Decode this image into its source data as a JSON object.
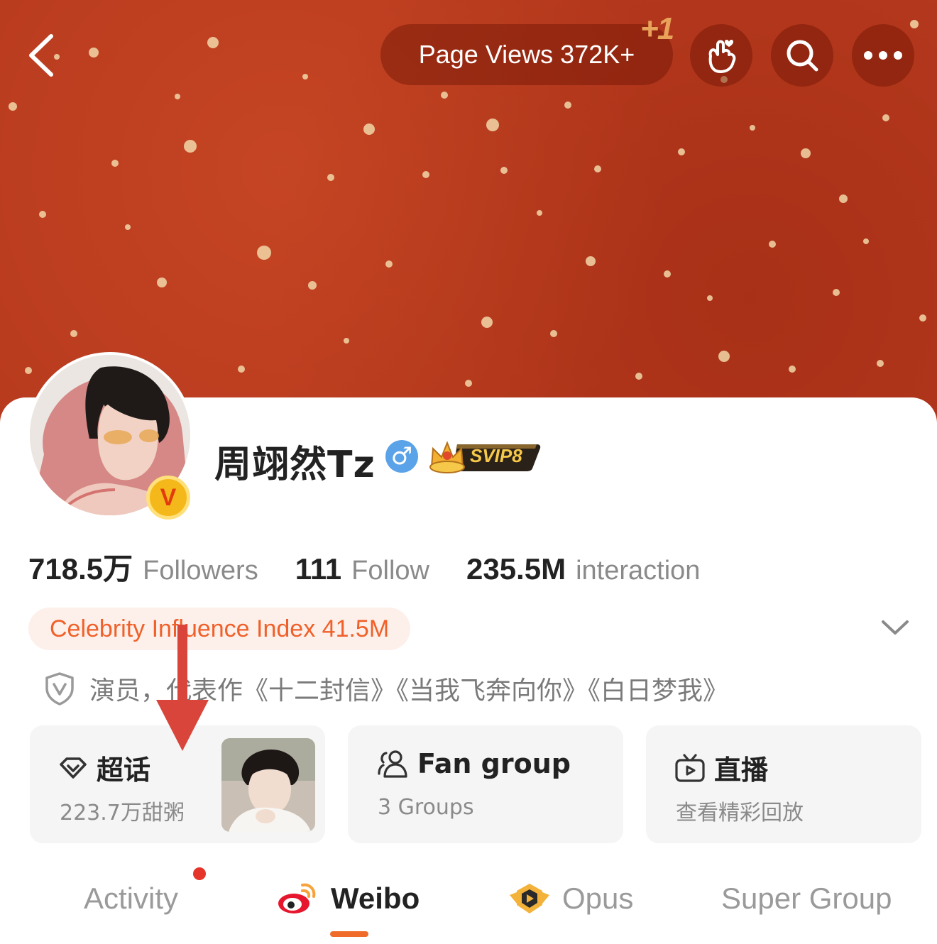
{
  "header": {
    "page_views_label": "Page Views 372K+",
    "plus_one": "+1"
  },
  "profile": {
    "username": "周翊然Tz",
    "gender_symbol": "♂",
    "vip_badge": "SVIP8",
    "verified_mark": "V"
  },
  "stats": [
    {
      "value": "718.5万",
      "label": "Followers"
    },
    {
      "value": "111",
      "label": "Follow"
    },
    {
      "value": "235.5M",
      "label": "interaction"
    }
  ],
  "influence": {
    "label": "Celebrity Influence Index 41.5M"
  },
  "bio": {
    "text": "演员，代表作《十二封信》《当我飞奔向你》《白日梦我》"
  },
  "feature_cards": [
    {
      "title": "超话",
      "subtitle": "223.7万甜粥",
      "icon": "diamond-icon"
    },
    {
      "title": "Fan group",
      "subtitle": "3 Groups",
      "icon": "group-icon"
    },
    {
      "title": "直播",
      "subtitle": "查看精彩回放",
      "icon": "tv-icon"
    }
  ],
  "tabs": [
    {
      "label": "Activity",
      "active": false
    },
    {
      "label": "Weibo",
      "active": true
    },
    {
      "label": "Opus",
      "active": false
    },
    {
      "label": "Super Group",
      "active": false
    }
  ],
  "colors": {
    "cover": "#b83a1e",
    "accent": "#f06a2a",
    "influence_bg": "#fdf0ea",
    "red_dot": "#e5352b",
    "annotation_arrow": "#d9453a"
  }
}
